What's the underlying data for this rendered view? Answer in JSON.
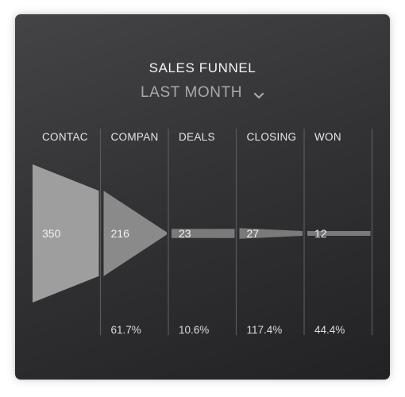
{
  "header": {
    "title": "SALES FUNNEL",
    "period_selected": "LAST MONTH",
    "period_icon": "chevron-down-icon"
  },
  "colors": {
    "card_bg": "#333335",
    "stage_fill_1": "#9e9e9f",
    "stage_fill_2": "#8a8a8b",
    "stage_fill_3": "#7a7a7b",
    "divider": "#5a5a5c",
    "text": "#e6e6e6"
  },
  "chart_data": {
    "type": "funnel",
    "title": "SALES FUNNEL",
    "subtitle": "LAST MONTH",
    "categories": [
      "CONTAC",
      "COMPAN",
      "DEALS",
      "CLOSING",
      "WON"
    ],
    "values": [
      350,
      216,
      23,
      27,
      12
    ],
    "conversion_labels": [
      "",
      "61.7%",
      "10.6%",
      "117.4%",
      "44.4%"
    ],
    "conversion_rates": [
      null,
      61.7,
      10.6,
      117.4,
      44.4
    ],
    "legend": "none",
    "grid": "vertical dividers between stages"
  }
}
